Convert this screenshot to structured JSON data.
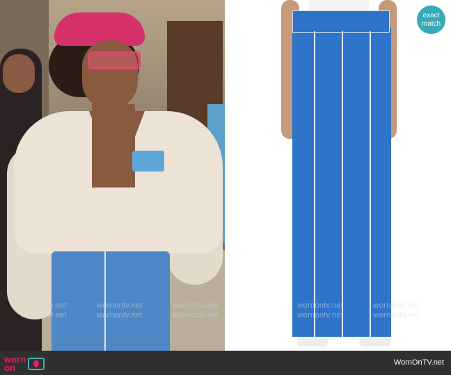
{
  "badge": {
    "line1": "exact",
    "line2": "match"
  },
  "watermark": {
    "text": "wornontv.net"
  },
  "footer": {
    "logo_word1": "worn",
    "logo_word2": "on",
    "site": "WornOnTV.net"
  },
  "colors": {
    "badge_teal": "#37a9b8",
    "brand_pink": "#e91e63",
    "jeans_blue": "#2e74c9",
    "footer_bg": "#303030"
  },
  "icons": [
    "tv-dress-logo-icon"
  ]
}
